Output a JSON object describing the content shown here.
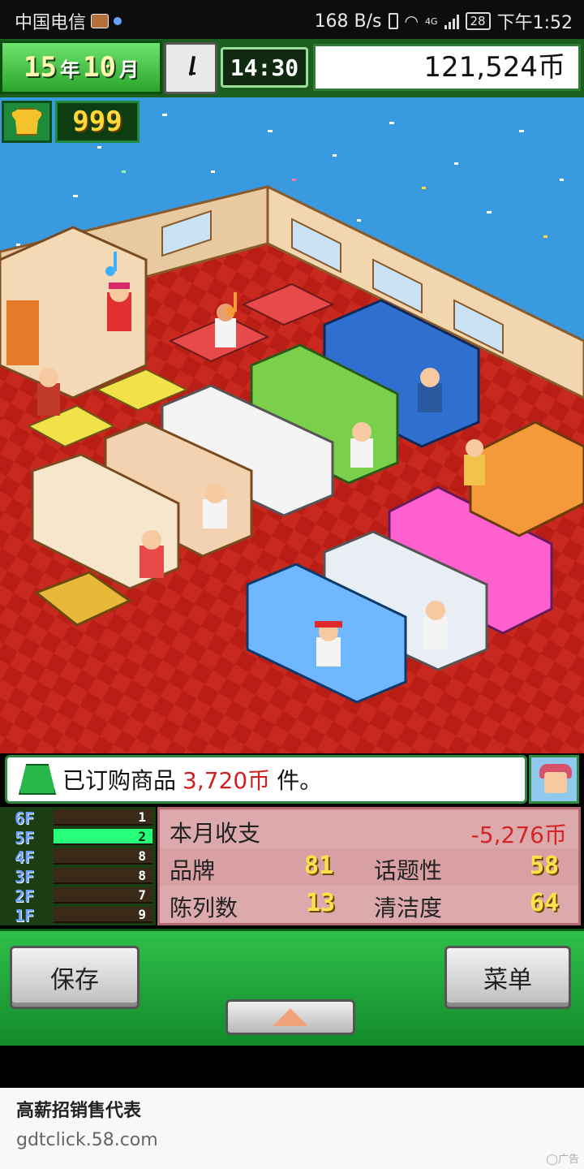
{
  "status_bar": {
    "carrier": "中国电信",
    "speed": "168 B/s",
    "network": "4G",
    "battery": "28",
    "time": "下午1:52"
  },
  "hud": {
    "year": "15",
    "year_unit": "年",
    "month": "10",
    "month_unit": "月",
    "clock_time": "14:30",
    "money": "121,524币"
  },
  "item_badge": {
    "value": "999",
    "icon": "shirt-icon"
  },
  "message": {
    "text_before": "已订购商品",
    "amount": "3,720币",
    "text_after": "件。"
  },
  "floors": [
    {
      "label": "6F",
      "count": "1",
      "active": false
    },
    {
      "label": "5F",
      "count": "2",
      "active": true
    },
    {
      "label": "4F",
      "count": "8",
      "active": false
    },
    {
      "label": "3F",
      "count": "8",
      "active": false
    },
    {
      "label": "2F",
      "count": "7",
      "active": false
    },
    {
      "label": "1F",
      "count": "9",
      "active": false
    }
  ],
  "stats": {
    "monthly_label": "本月收支",
    "monthly_value": "-5,276币",
    "brand_label": "品牌",
    "brand_value": "81",
    "topic_label": "话题性",
    "topic_value": "58",
    "display_label": "陈列数",
    "display_value": "13",
    "clean_label": "清洁度",
    "clean_value": "64"
  },
  "buttons": {
    "save": "保存",
    "menu": "菜单"
  },
  "ad": {
    "title": "高薪招销售代表",
    "url": "gdtclick.58.com",
    "tag": "广告"
  },
  "colors": {
    "accent_green": "#2fbf4a",
    "floor_active": "#27ff7a",
    "stats_bg": "#d9a0a4",
    "negative": "#d42424",
    "pixel_gold": "#ffe14a"
  }
}
